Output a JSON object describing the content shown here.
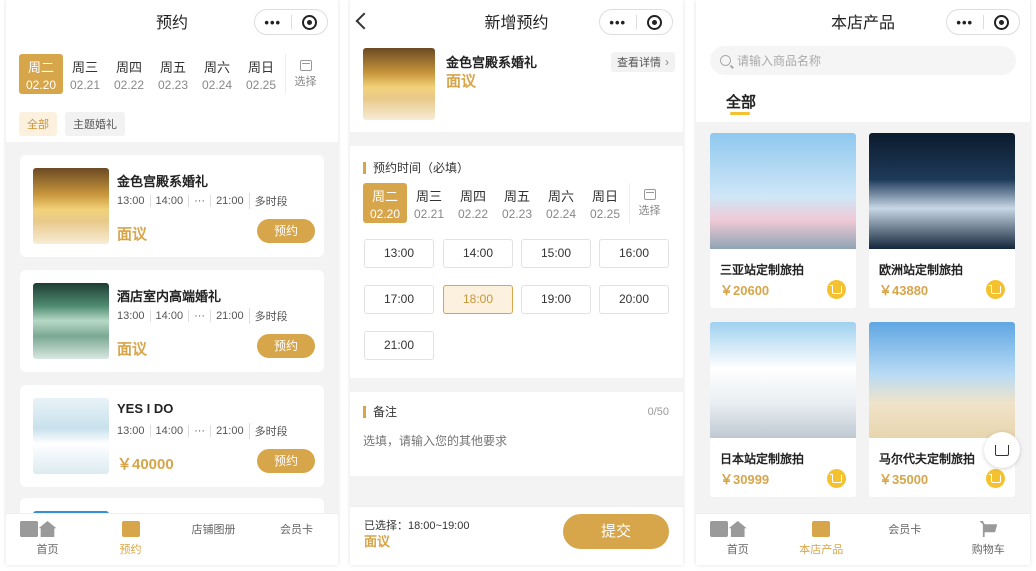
{
  "colors": {
    "accent": "#d7a54a",
    "accent_light": "#fbf1de",
    "cart_yellow": "#f4c230"
  },
  "capsule": {
    "more": "•••"
  },
  "dates": [
    {
      "week": "周二",
      "date": "02.20",
      "selected": true
    },
    {
      "week": "周三",
      "date": "02.21"
    },
    {
      "week": "周四",
      "date": "02.22"
    },
    {
      "week": "周五",
      "date": "02.23"
    },
    {
      "week": "周六",
      "date": "02.24"
    },
    {
      "week": "周日",
      "date": "02.25"
    }
  ],
  "date_picker_label": "选择",
  "screen1": {
    "title": "预约",
    "filters": [
      "全部",
      "主题婚礼"
    ],
    "items": [
      {
        "title": "金色宫殿系婚礼",
        "slots": [
          "13:00",
          "14:00",
          "···",
          "21:00",
          "多时段"
        ],
        "price": "面议",
        "button": "预约"
      },
      {
        "title": "酒店室内高端婚礼",
        "slots": [
          "13:00",
          "14:00",
          "···",
          "21:00",
          "多时段"
        ],
        "price": "面议",
        "button": "预约"
      },
      {
        "title": "YES I DO",
        "slots": [
          "13:00",
          "14:00",
          "···",
          "21:00",
          "多时段"
        ],
        "price": "￥40000",
        "button": "预约"
      }
    ],
    "tabbar": [
      {
        "label": "首页",
        "icon": "home-icon"
      },
      {
        "label": "预约",
        "icon": "calendar-check-icon",
        "selected": true
      },
      {
        "label": "店铺图册",
        "icon": "album-icon"
      },
      {
        "label": "会员卡",
        "icon": "member-card-icon"
      }
    ]
  },
  "screen2": {
    "title": "新增预约",
    "product": {
      "title": "金色宫殿系婚礼",
      "price": "面议",
      "detail_link": "查看详情"
    },
    "time_label": "预约时间（必填）",
    "times": [
      "13:00",
      "14:00",
      "15:00",
      "16:00",
      "17:00",
      "18:00",
      "19:00",
      "20:00",
      "21:00"
    ],
    "selected_time": "18:00",
    "remark_label": "备注",
    "remark_count": "0/50",
    "remark_placeholder": "选填，请输入您的其他要求",
    "selected_summary": "已选择：18:00~19:00",
    "summary_price": "面议",
    "submit": "提交"
  },
  "screen3": {
    "title": "本店产品",
    "search_placeholder": "请输入商品名称",
    "tab": "全部",
    "products": [
      {
        "name": "三亚站定制旅拍",
        "price": "￥20600"
      },
      {
        "name": "欧洲站定制旅拍",
        "price": "￥43880"
      },
      {
        "name": "日本站定制旅拍",
        "price": "￥30999"
      },
      {
        "name": "马尔代夫定制旅拍",
        "price": "￥35000"
      }
    ],
    "tabbar": [
      {
        "label": "首页",
        "icon": "home-icon"
      },
      {
        "label": "本店产品",
        "icon": "products-icon",
        "selected": true
      },
      {
        "label": "会员卡",
        "icon": "member-card-icon"
      },
      {
        "label": "购物车",
        "icon": "cart-icon"
      }
    ]
  }
}
